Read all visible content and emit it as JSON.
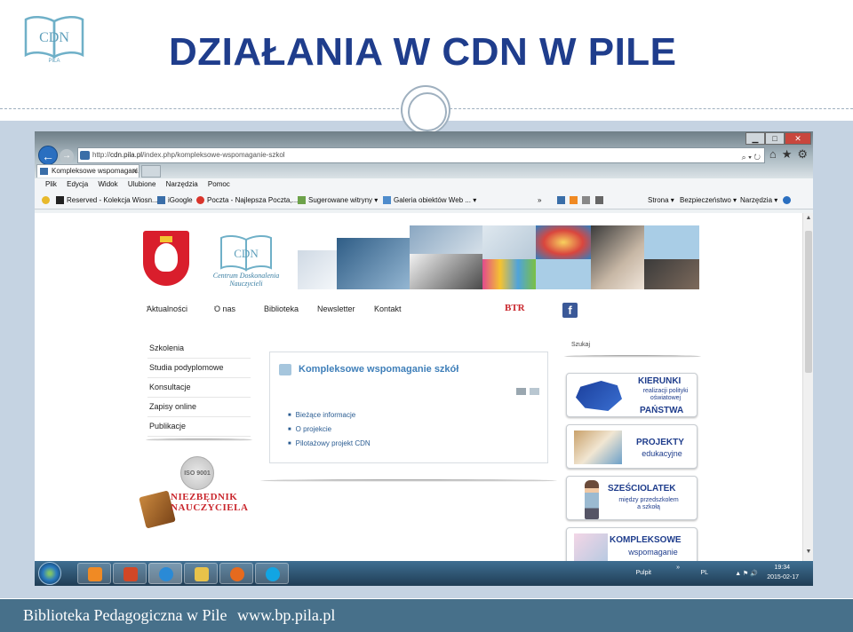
{
  "slide": {
    "title": "DZIAŁANIA W CDN W PILE",
    "footer_left": "Biblioteka Pedagogiczna w Pile",
    "footer_right": "www.bp.pila.pl",
    "logo": {
      "text_top": "CDN",
      "text_bottom": "PIŁA"
    },
    "colors": {
      "title": "#1f3d8c",
      "footer": "#47708a",
      "band": "#c5d3e2"
    }
  },
  "browser": {
    "url_prefix": "http://",
    "url_host": "cdn.pila.pl",
    "url_path": "/index.php/kompleksowe-wspomaganie-szkol",
    "address_controls": "⌕ ▾ ↻",
    "tab_title": "Kompleksowe wspomagani...",
    "tab_close": "✕",
    "window_controls": [
      "▁",
      "□",
      "✕"
    ],
    "toolbar_icons": [
      "⌂",
      "★",
      "⚙"
    ],
    "menu": [
      "Plik",
      "Edycja",
      "Widok",
      "Ulubione",
      "Narzędzia",
      "Pomoc"
    ],
    "favorites": [
      "Reserved - Kolekcja Wiosn...",
      "iGoogle",
      "Poczta - Najlepsza Poczta,...",
      "Sugerowane witryny ▾",
      "Galeria obiektów Web ... ▾"
    ],
    "command_bar": [
      "Strona ▾",
      "Bezpieczeństwo ▾",
      "Narzędzia ▾"
    ],
    "command_more": "»"
  },
  "site": {
    "logo_name": "Centrum Doskonalenia Nauczycieli",
    "logo_acronym": "CDN",
    "nav": [
      "Aktualności",
      "O nas",
      "Biblioteka",
      "Newsletter",
      "Kontakt"
    ],
    "nav_caret": "▾",
    "btr_logo": "BTR",
    "facebook_glyph": "f",
    "left_menu": [
      "Szkolenia",
      "Studia podyplomowe",
      "Konsultacje",
      "Zapisy online",
      "Publikacje"
    ],
    "iso_badge": "ISO 9001",
    "niezbednik": [
      "NIEZBĘDNIK",
      "NAUCZYCIELA"
    ],
    "article": {
      "title": "Kompleksowe wspomaganie szkół",
      "links": [
        "Bieżące informacje",
        "O projekcie",
        "Pilotażowy projekt CDN"
      ]
    },
    "search_label": "Szukaj",
    "right_boxes": [
      {
        "title": "KIERUNKI",
        "sub": [
          "realizacji polityki",
          "oświatowej"
        ],
        "title2": "PAŃSTWA"
      },
      {
        "title": "PROJEKTY",
        "sub": [
          "edukacyjne"
        ]
      },
      {
        "title": "SZEŚCIOLATEK",
        "sub": [
          "między przedszkolem",
          "a szkołą"
        ]
      },
      {
        "title": "KOMPLEKSOWE",
        "sub": [
          "wspomaganie"
        ]
      }
    ]
  },
  "taskbar": {
    "tray_label": "Pulpit",
    "tray_more": "»",
    "language": "PL",
    "tray_icons": "▲ ⚑ 🔊",
    "time": "19:34",
    "date": "2015-02-17"
  }
}
